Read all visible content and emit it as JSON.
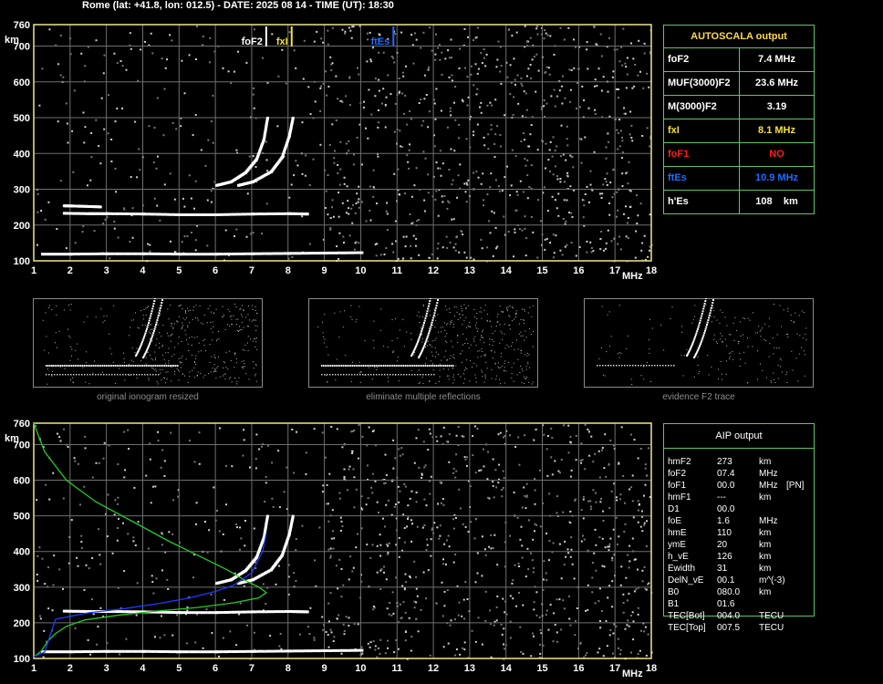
{
  "header": {
    "title": "Rome (lat: +41.8, lon: 012.5) - DATE: 2025 08 14 - TIME (UT): 18:30"
  },
  "colors": {
    "axis": "#f0e68c",
    "grid": "#6f6f6f",
    "table_border": "#62c36a",
    "fxI": "#f2e23a",
    "ftEs": "#1e6cff",
    "foF1": "#ff1e1e",
    "profile_green": "#22cc22",
    "profile_blue": "#1c3bff"
  },
  "chart_data": [
    {
      "type": "scatter",
      "id": "top-ionogram",
      "xlabel": "MHz",
      "ylabel": "km",
      "xlim": [
        1,
        18
      ],
      "ylim": [
        100,
        760
      ],
      "x_ticks": [
        "1",
        "2",
        "3",
        "4",
        "5",
        "6",
        "7",
        "8",
        "9",
        "10",
        "11",
        "12",
        "13",
        "14",
        "15",
        "16",
        "17",
        "18"
      ],
      "y_ticks": [
        "100",
        "200",
        "300",
        "400",
        "500",
        "600",
        "700",
        "760"
      ],
      "grid": true,
      "markers": [
        {
          "label": "foF2",
          "x": 7.4,
          "color": "#ffffff"
        },
        {
          "label": "fxI",
          "x": 8.1,
          "color": "#f2e23a"
        },
        {
          "label": "ftEs",
          "x": 10.9,
          "color": "#1e6cff"
        }
      ],
      "traces": [
        {
          "name": "Es",
          "points": [
            [
              1.2,
              120
            ],
            [
              2,
              120
            ],
            [
              3,
              121
            ],
            [
              4,
              121
            ],
            [
              5,
              120
            ],
            [
              6,
              120
            ],
            [
              7,
              121
            ],
            [
              8,
              122
            ],
            [
              9,
              123
            ],
            [
              10,
              124
            ]
          ]
        },
        {
          "name": "Es-multiple",
          "points": [
            [
              1.8,
              234
            ],
            [
              2.5,
              233
            ],
            [
              3,
              233
            ],
            [
              4,
              232
            ],
            [
              5,
              230
            ],
            [
              6,
              230
            ],
            [
              7,
              232
            ],
            [
              8,
              233
            ],
            [
              8.5,
              232
            ]
          ]
        },
        {
          "name": "Es-multiple-2",
          "points": [
            [
              1.8,
              255
            ],
            [
              2.2,
              254
            ],
            [
              2.8,
              252
            ]
          ]
        },
        {
          "name": "F2-o",
          "points": [
            [
              6,
              312
            ],
            [
              6.4,
              322
            ],
            [
              6.8,
              348
            ],
            [
              7.1,
              385
            ],
            [
              7.3,
              440
            ],
            [
              7.4,
              500
            ]
          ]
        },
        {
          "name": "F2-x",
          "points": [
            [
              6.6,
              312
            ],
            [
              7,
              322
            ],
            [
              7.5,
              350
            ],
            [
              7.8,
              390
            ],
            [
              8,
              450
            ],
            [
              8.1,
              500
            ]
          ]
        }
      ]
    },
    {
      "type": "scatter",
      "id": "bottom-ionogram",
      "xlabel": "MHz",
      "ylabel": "km",
      "xlim": [
        1,
        18
      ],
      "ylim": [
        100,
        760
      ],
      "x_ticks": [
        "1",
        "2",
        "3",
        "4",
        "5",
        "6",
        "7",
        "8",
        "9",
        "10",
        "11",
        "12",
        "13",
        "14",
        "15",
        "16",
        "17",
        "18"
      ],
      "y_ticks": [
        "100",
        "200",
        "300",
        "400",
        "500",
        "600",
        "700",
        "760"
      ],
      "grid": true,
      "profiles": [
        {
          "name": "green",
          "points": [
            [
              1,
              760
            ],
            [
              1.3,
              680
            ],
            [
              1.9,
              600
            ],
            [
              2.7,
              540
            ],
            [
              3.8,
              480
            ],
            [
              4.7,
              430
            ],
            [
              5.6,
              385
            ],
            [
              6.3,
              350
            ],
            [
              6.8,
              320
            ],
            [
              7.2,
              300
            ],
            [
              7.4,
              285
            ],
            [
              7.2,
              270
            ],
            [
              6.5,
              256
            ],
            [
              5.5,
              243
            ],
            [
              4.3,
              232
            ],
            [
              3.3,
              221
            ],
            [
              2.4,
              208
            ],
            [
              1.9,
              190
            ],
            [
              1.6,
              170
            ],
            [
              1.4,
              150
            ],
            [
              1.3,
              135
            ],
            [
              1.2,
              120
            ],
            [
              1.1,
              112
            ],
            [
              1,
              105
            ]
          ]
        },
        {
          "name": "blue",
          "points": [
            [
              1,
              105
            ],
            [
              1.3,
              118
            ],
            [
              1.6,
              210
            ],
            [
              2.5,
              228
            ],
            [
              3.5,
              240
            ],
            [
              4.5,
              255
            ],
            [
              5.3,
              270
            ],
            [
              6,
              288
            ],
            [
              6.5,
              305
            ],
            [
              7,
              340
            ],
            [
              7.3,
              400
            ],
            [
              7.4,
              450
            ]
          ]
        }
      ],
      "traces": [
        {
          "name": "Es",
          "points": [
            [
              1.2,
              120
            ],
            [
              2,
              120
            ],
            [
              3,
              121
            ],
            [
              4,
              121
            ],
            [
              5,
              120
            ],
            [
              6,
              120
            ],
            [
              7,
              121
            ],
            [
              8,
              122
            ],
            [
              9,
              123
            ],
            [
              10,
              124
            ]
          ]
        },
        {
          "name": "Es-multiple",
          "points": [
            [
              1.8,
              234
            ],
            [
              2.5,
              233
            ],
            [
              3,
              233
            ],
            [
              4,
              232
            ],
            [
              5,
              230
            ],
            [
              6,
              230
            ],
            [
              7,
              232
            ],
            [
              8,
              233
            ],
            [
              8.5,
              232
            ]
          ]
        },
        {
          "name": "F2-o",
          "points": [
            [
              6,
              312
            ],
            [
              6.4,
              322
            ],
            [
              6.8,
              348
            ],
            [
              7.1,
              385
            ],
            [
              7.3,
              440
            ],
            [
              7.4,
              500
            ]
          ]
        },
        {
          "name": "F2-x",
          "points": [
            [
              6.6,
              312
            ],
            [
              7,
              322
            ],
            [
              7.5,
              350
            ],
            [
              7.8,
              390
            ],
            [
              8,
              450
            ],
            [
              8.1,
              500
            ]
          ]
        }
      ]
    }
  ],
  "autoscala": {
    "title": "AUTOSCALA output",
    "rows": [
      {
        "key": "foF2",
        "val": "7.4 MHz",
        "color": "#ffffff"
      },
      {
        "key": "MUF(3000)F2",
        "val": "23.6 MHz",
        "color": "#ffffff"
      },
      {
        "key": "M(3000)F2",
        "val": "3.19",
        "color": "#ffffff"
      },
      {
        "key": "fxI",
        "val": "8.1 MHz",
        "color": "#f2e23a"
      },
      {
        "key": "foF1",
        "val": "NO",
        "color": "#ff1e1e"
      },
      {
        "key": "ftEs",
        "val": "10.9 MHz",
        "color": "#1e6cff"
      },
      {
        "key": "h'Es",
        "val": "108    km",
        "color": "#ffffff"
      }
    ]
  },
  "thumbnails": [
    {
      "caption": "original ionogram resized"
    },
    {
      "caption": "eliminate multiple reflections"
    },
    {
      "caption": "evidence F2 trace"
    }
  ],
  "aip": {
    "title": "AIP output",
    "rows": [
      {
        "n": "hmF2",
        "v": "273",
        "u": "km",
        "x": ""
      },
      {
        "n": "foF2",
        "v": "07.4",
        "u": "MHz",
        "x": ""
      },
      {
        "n": "foF1",
        "v": "00.0",
        "u": "MHz",
        "x": "[PN]"
      },
      {
        "n": "hmF1",
        "v": "---",
        "u": "km",
        "x": ""
      },
      {
        "n": "D1",
        "v": "00.0",
        "u": "",
        "x": ""
      },
      {
        "n": "foE",
        "v": "1.6",
        "u": "MHz",
        "x": ""
      },
      {
        "n": "hmE",
        "v": "110",
        "u": "km",
        "x": ""
      },
      {
        "n": "ymE",
        "v": "20",
        "u": "km",
        "x": ""
      },
      {
        "n": "h_vE",
        "v": "126",
        "u": "km",
        "x": ""
      },
      {
        "n": "Ewidth",
        "v": "31",
        "u": "km",
        "x": ""
      },
      {
        "n": "DelN_vE",
        "v": "00.1",
        "u": "m^(-3)",
        "x": ""
      },
      {
        "n": "B0",
        "v": "080.0",
        "u": "km",
        "x": ""
      },
      {
        "n": "B1",
        "v": "01.6",
        "u": "",
        "x": ""
      },
      {
        "n": "TEC[Bot]",
        "v": "004.0",
        "u": "TECU",
        "x": ""
      },
      {
        "n": "TEC[Top]",
        "v": "007.5",
        "u": "TECU",
        "x": ""
      }
    ]
  }
}
